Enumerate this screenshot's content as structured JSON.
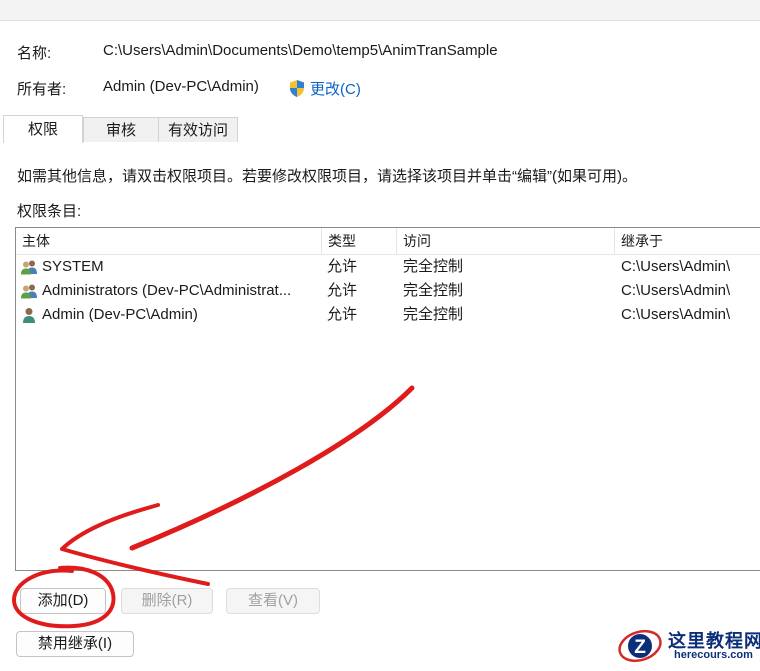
{
  "header": {
    "name_label": "名称:",
    "name_value": "C:\\Users\\Admin\\Documents\\Demo\\temp5\\AnimTranSample",
    "owner_label": "所有者:",
    "owner_value": "Admin (Dev-PC\\Admin)",
    "change_label": "更改(C)"
  },
  "tabs": [
    {
      "label": "权限",
      "active": true
    },
    {
      "label": "审核",
      "active": false
    },
    {
      "label": "有效访问",
      "active": false
    }
  ],
  "info_text": "如需其他信息，请双击权限项目。若要修改权限项目，请选择该项目并单击“编辑”(如果可用)。",
  "entries_label": "权限条目:",
  "table": {
    "columns": [
      "主体",
      "类型",
      "访问",
      "继承于"
    ],
    "rows": [
      {
        "principal": "SYSTEM",
        "type": "允许",
        "access": "完全控制",
        "inherited": "C:\\Users\\Admin\\",
        "icon": "group-user-icon"
      },
      {
        "principal": "Administrators (Dev-PC\\Administrat...",
        "type": "允许",
        "access": "完全控制",
        "inherited": "C:\\Users\\Admin\\",
        "icon": "group-user-icon"
      },
      {
        "principal": "Admin (Dev-PC\\Admin)",
        "type": "允许",
        "access": "完全控制",
        "inherited": "C:\\Users\\Admin\\",
        "icon": "single-user-icon"
      }
    ]
  },
  "buttons": {
    "add": "添加(D)",
    "remove": "删除(R)",
    "view": "查看(V)",
    "disable_inheritance": "禁用继承(I)"
  },
  "watermark": {
    "title": "这里教程网",
    "url": "herecours.com",
    "logo_letter": "Z"
  },
  "colors": {
    "link": "#0b63c7",
    "annotation": "#e01b1b",
    "watermark": "#0d2f7a"
  }
}
